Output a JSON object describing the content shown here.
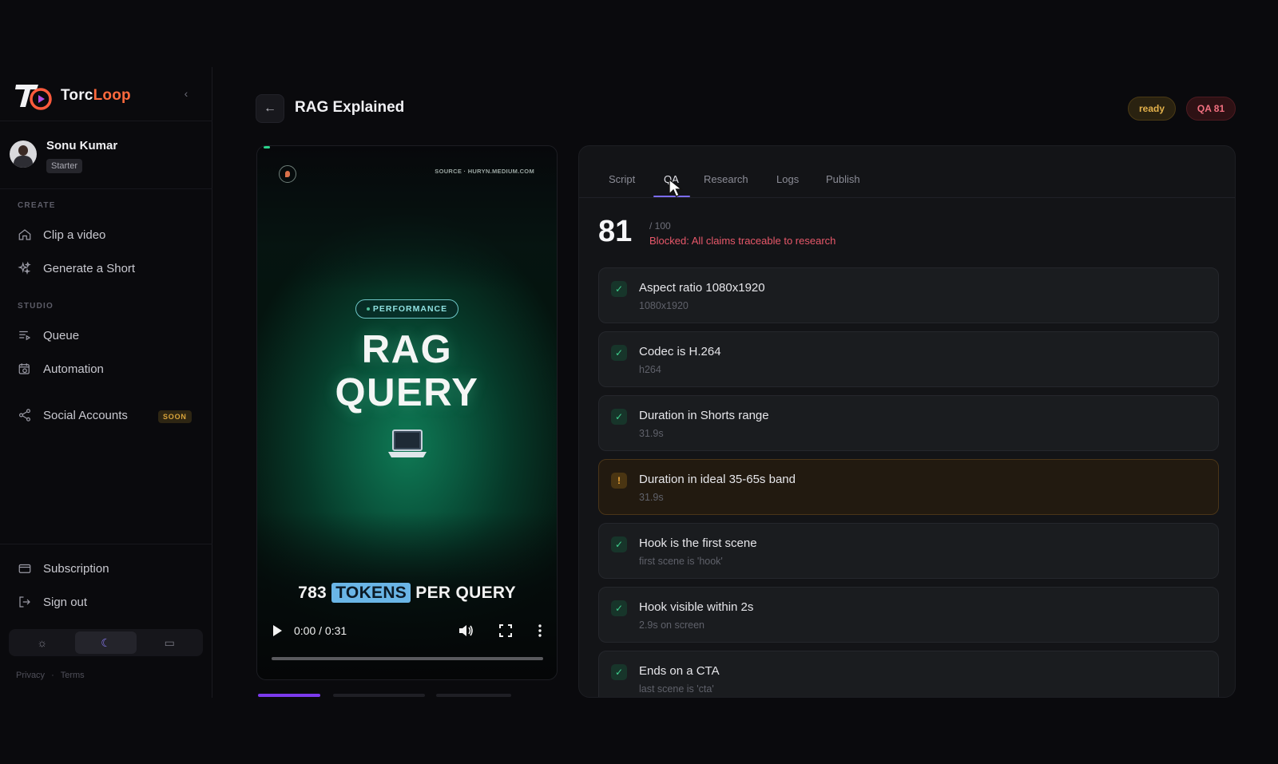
{
  "sidebar": {
    "brand_first": "Torc",
    "brand_second": "Loop",
    "user": {
      "name": "Sonu Kumar",
      "plan": "Starter"
    },
    "sections": {
      "create": "CREATE",
      "studio": "STUDIO"
    },
    "items": {
      "clip": "Clip a video",
      "generate": "Generate a Short",
      "queue": "Queue",
      "automation": "Automation",
      "social": "Social Accounts",
      "social_badge": "SOON",
      "subscription": "Subscription",
      "signout": "Sign out"
    },
    "theme_active": "dark",
    "legal": {
      "privacy": "Privacy",
      "dot": "·",
      "terms": "Terms"
    }
  },
  "header": {
    "title": "RAG Explained",
    "status_badge": "ready",
    "qa_badge": "QA 81"
  },
  "video": {
    "source": "SOURCE · HURYN.MEDIUM.COM",
    "tag": "PERFORMANCE",
    "title_line1": "RAG",
    "title_line2": "QUERY",
    "caption_pre": "783",
    "caption_highlight": "TOKENS",
    "caption_post": "PER QUERY",
    "time": "0:00 / 0:31"
  },
  "panel": {
    "tabs": [
      "Script",
      "QA",
      "Research",
      "Logs",
      "Publish"
    ],
    "active_tab": "QA",
    "score": "81",
    "score_max": "/ 100",
    "blocked_text": "Blocked: All claims traceable to research",
    "checks": [
      {
        "status": "pass",
        "title": "Aspect ratio 1080x1920",
        "detail": "1080x1920"
      },
      {
        "status": "pass",
        "title": "Codec is H.264",
        "detail": "h264"
      },
      {
        "status": "pass",
        "title": "Duration in Shorts range",
        "detail": "31.9s"
      },
      {
        "status": "warn",
        "title": "Duration in ideal 35-65s band",
        "detail": "31.9s"
      },
      {
        "status": "pass",
        "title": "Hook is the first scene",
        "detail": "first scene is 'hook'"
      },
      {
        "status": "pass",
        "title": "Hook visible within 2s",
        "detail": "2.9s on screen"
      },
      {
        "status": "pass",
        "title": "Ends on a CTA",
        "detail": "last scene is 'cta'"
      }
    ]
  },
  "colors": {
    "accent": "#7c6cf0",
    "brand_orange": "#ff6a3d",
    "pass": "#3fcf8e",
    "warn": "#f0a93a",
    "danger": "#e8586a"
  }
}
